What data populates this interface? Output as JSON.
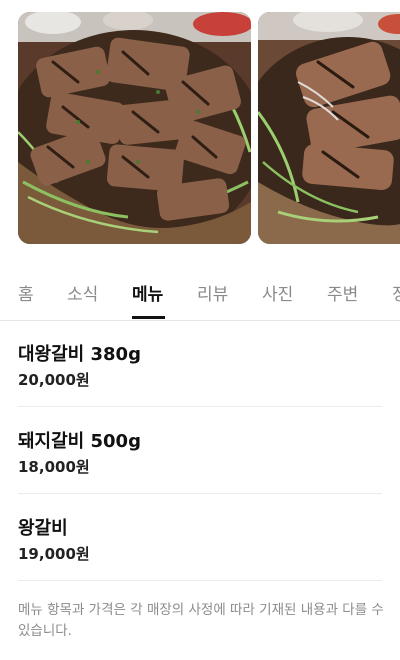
{
  "gallery": {
    "photos": [
      {
        "icon": "grilled-galbi-photo"
      },
      {
        "icon": "grilled-galbi-photo"
      }
    ]
  },
  "tabs": [
    {
      "label": "홈",
      "active": false
    },
    {
      "label": "소식",
      "active": false
    },
    {
      "label": "메뉴",
      "active": true
    },
    {
      "label": "리뷰",
      "active": false
    },
    {
      "label": "사진",
      "active": false
    },
    {
      "label": "주변",
      "active": false
    },
    {
      "label": "정",
      "active": false
    }
  ],
  "menu": [
    {
      "name": "대왕갈비 380g",
      "price": "20,000원"
    },
    {
      "name": "돼지갈비 500g",
      "price": "18,000원"
    },
    {
      "name": "왕갈비",
      "price": "19,000원"
    }
  ],
  "notice": "메뉴 항목과 가격은 각 매장의 사정에 따라 기재된 내용과 다를 수 있습니다.",
  "colors": {
    "text_primary": "#111111",
    "text_muted": "#8a8a8a",
    "divider": "#ececec"
  }
}
